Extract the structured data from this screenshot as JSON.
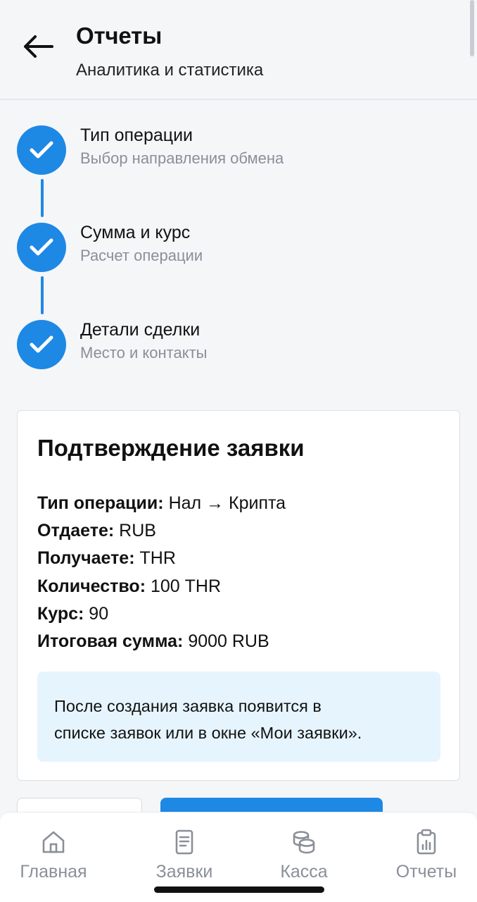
{
  "header": {
    "title": "Отчеты",
    "subtitle": "Аналитика и статистика"
  },
  "stepper": {
    "steps": [
      {
        "title": "Тип операции",
        "subtitle": "Выбор направления обмена",
        "status": "completed"
      },
      {
        "title": "Сумма и курс",
        "subtitle": "Расчет операции",
        "status": "completed"
      },
      {
        "title": "Детали сделки",
        "subtitle": "Место и контакты",
        "status": "completed"
      }
    ]
  },
  "confirmation": {
    "title": "Подтверждение заявки",
    "rows": [
      {
        "label": "Тип операции:",
        "value": "Нал → Крипта"
      },
      {
        "label": "Отдаете:",
        "value": "RUB"
      },
      {
        "label": "Получаете:",
        "value": "THR"
      },
      {
        "label": "Количество:",
        "value": "100 THR"
      },
      {
        "label": "Курс:",
        "value": "90"
      },
      {
        "label": "Итоговая сумма:",
        "value": "9000 RUB"
      }
    ],
    "info_line1": "После создания заявка появится в",
    "info_line2": "списке заявок или в окне «Мои заявки»."
  },
  "nav": {
    "items": [
      {
        "label": "Главная",
        "icon": "home-icon"
      },
      {
        "label": "Заявки",
        "icon": "document-icon"
      },
      {
        "label": "Касса",
        "icon": "coins-icon"
      },
      {
        "label": "Отчеты",
        "icon": "clipboard-chart-icon"
      }
    ]
  },
  "colors": {
    "accent": "#1e88e5",
    "info_bg": "#e6f4fd",
    "muted_text": "#8a8f98",
    "background": "#f5f6f8"
  }
}
